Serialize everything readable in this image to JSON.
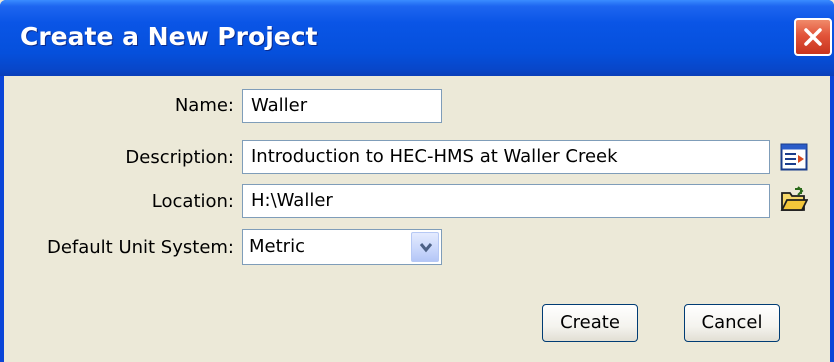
{
  "window": {
    "title": "Create a New Project"
  },
  "form": {
    "name_label": "Name:",
    "name_value": "Waller",
    "description_label": "Description:",
    "description_value": "Introduction to HEC-HMS at Waller Creek",
    "location_label": "Location:",
    "location_value": "H:\\Waller",
    "unit_label": "Default Unit System:",
    "unit_value": "Metric"
  },
  "buttons": {
    "create": "Create",
    "cancel": "Cancel"
  },
  "icons": {
    "close": "close-icon",
    "description_editor": "text-editor-icon",
    "browse_folder": "open-folder-icon",
    "dropdown": "chevron-down-icon"
  },
  "colors": {
    "titlebar": "#0550DC",
    "dialog_bg": "#ECE9D8",
    "close_button": "#E2543A"
  }
}
